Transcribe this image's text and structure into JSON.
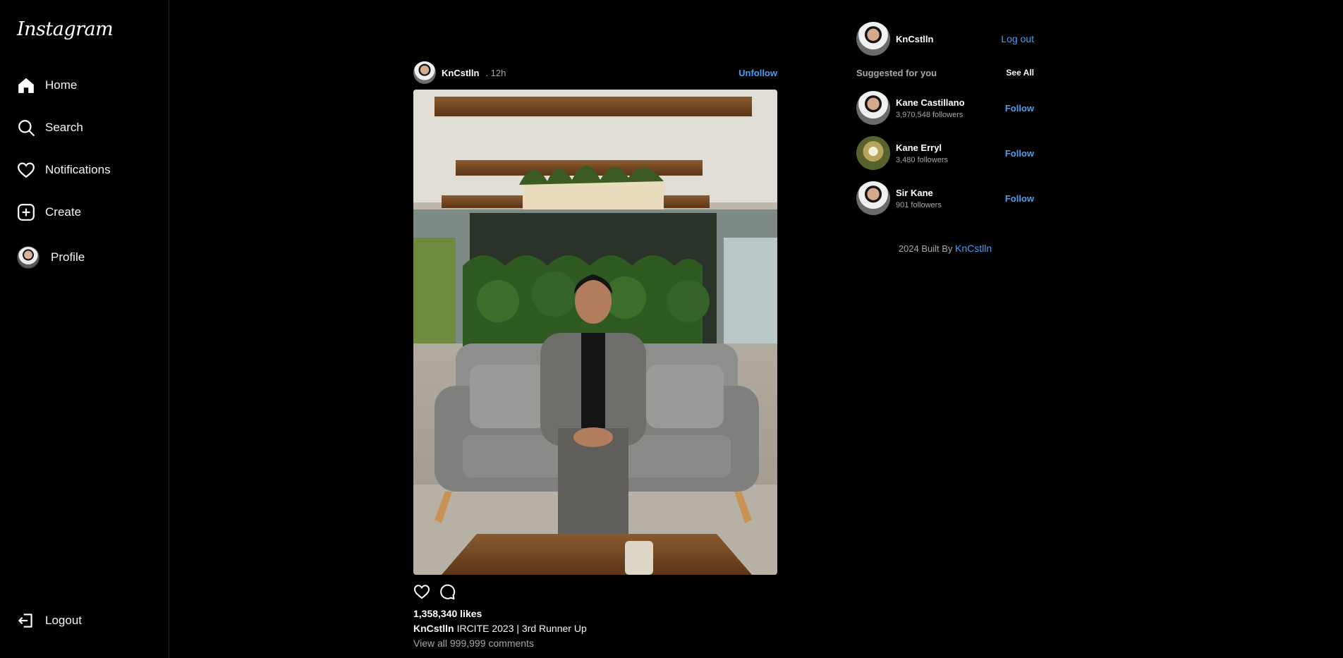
{
  "sidebar": {
    "logo": "Instagram",
    "items": [
      {
        "label": "Home",
        "icon": "home-icon"
      },
      {
        "label": "Search",
        "icon": "search-icon"
      },
      {
        "label": "Notifications",
        "icon": "heart-icon"
      },
      {
        "label": "Create",
        "icon": "plus-square-icon"
      },
      {
        "label": "Profile",
        "icon": "avatar"
      }
    ],
    "logout": "Logout"
  },
  "post": {
    "username": "KnCstlln",
    "time": ". 12h",
    "unfollow": "Unfollow",
    "likes": "1,358,340 likes",
    "caption_user": "KnCstlln",
    "caption_text": "IRCITE 2023 | 3rd Runner Up",
    "view_comments": "View all 999,999 comments"
  },
  "profile": {
    "username": "KnCstlln",
    "logout": "Log out"
  },
  "suggestions": {
    "title": "Suggested for you",
    "see_all": "See All",
    "items": [
      {
        "name": "Kane Castillano",
        "followers": "3,970,548 followers",
        "action": "Follow"
      },
      {
        "name": "Kane Erryl",
        "followers": "3,480 followers",
        "action": "Follow"
      },
      {
        "name": "Sir Kane",
        "followers": "901 followers",
        "action": "Follow"
      }
    ]
  },
  "footer": {
    "text": "2024 Built By",
    "author": "KnCstlln"
  },
  "colors": {
    "background": "#000000",
    "link": "#4a9df5",
    "muted": "#a8a8a8"
  }
}
